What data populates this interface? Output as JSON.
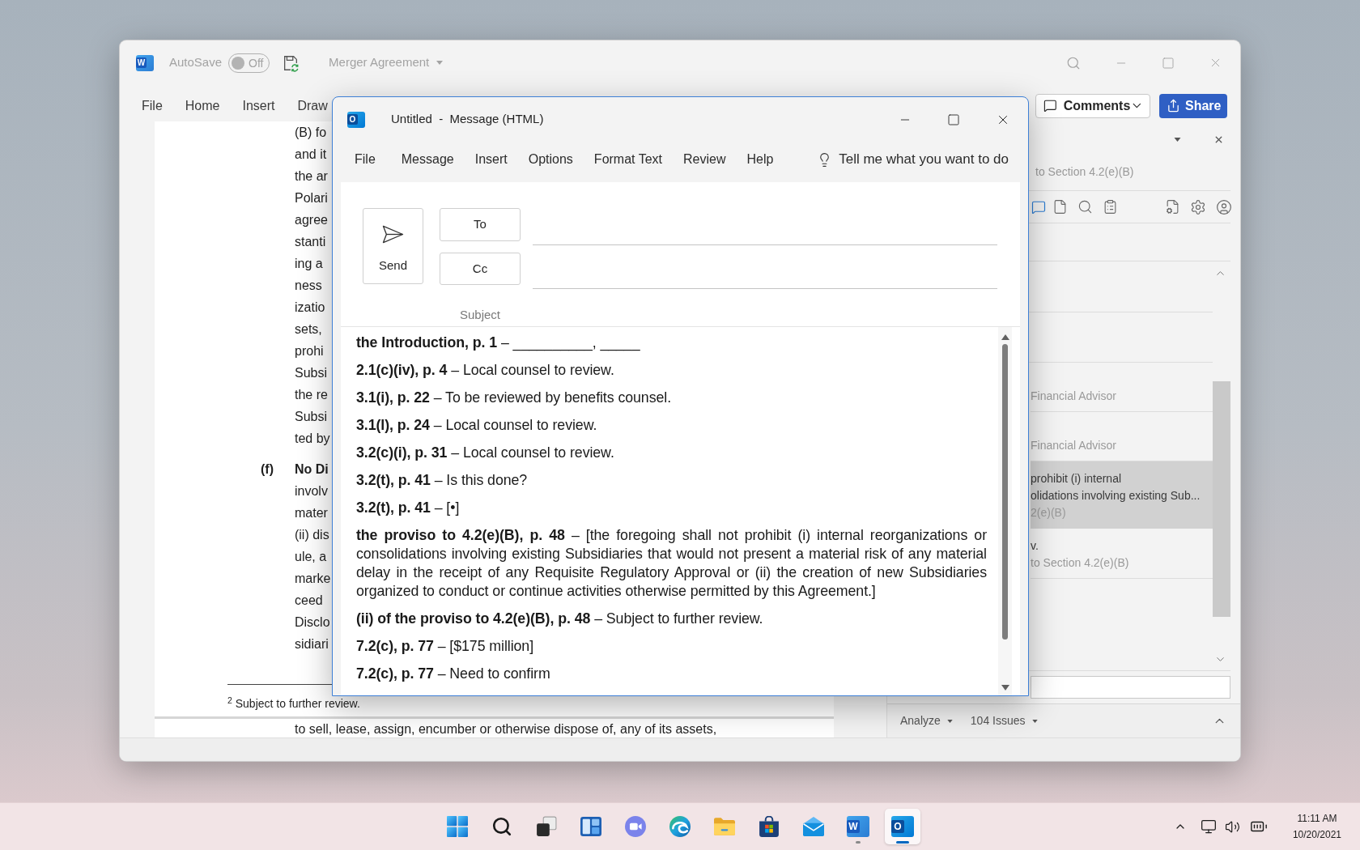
{
  "word_window": {
    "logo_text": "W",
    "autosave": {
      "label": "AutoSave",
      "on": false,
      "state_text": "Off"
    },
    "document_title": "Merger Agreement",
    "ribbon_tabs": [
      "File",
      "Home",
      "Insert",
      "Draw"
    ],
    "comments_button": "Comments",
    "share_button": "Share",
    "document": {
      "clause_lines": [
        "(B) fo",
        "and it",
        "the ar",
        "Polari",
        "agree",
        "stanti",
        "ing a",
        "ness",
        "izatio",
        "sets,",
        "prohi",
        "Subsi",
        "the re",
        "Subsi",
        "ted by"
      ],
      "subsection": {
        "marker": "(f)",
        "heading": "No Di",
        "lines": [
          "involv",
          "mater",
          "(ii) dis",
          "ule, a",
          "marke",
          "ceed",
          "Disclo",
          "sidiari"
        ]
      },
      "footnote": "$^{2}$ Subject to further review.",
      "next_page_line": "to sell, lease, assign, encumber or otherwise dispose of, any of its assets,"
    },
    "side_pane": {
      "subtitle": "to Section 4.2(e)(B)",
      "items": [
        {
          "selected": false,
          "lines": [
            {
              "kind": "secondary",
              "text": "Financial Advisor"
            }
          ]
        },
        {
          "selected": false,
          "lines": [
            {
              "kind": "secondary",
              "text": "Financial Advisor"
            }
          ]
        },
        {
          "selected": true,
          "lines": [
            {
              "kind": "primary",
              "text": "prohibit (i) internal"
            },
            {
              "kind": "primary",
              "text": "olidations involving existing Sub..."
            },
            {
              "kind": "secondary",
              "text": "2(e)(B)"
            }
          ]
        },
        {
          "selected": false,
          "lines": [
            {
              "kind": "primary",
              "text": "v."
            },
            {
              "kind": "secondary",
              "text": "to Section 4.2(e)(B)"
            }
          ]
        }
      ]
    },
    "status_bar": {
      "analyze": "Analyze",
      "issues": "104 Issues"
    }
  },
  "outlook_window": {
    "logo_text": "O",
    "title": "Untitled  -  Message (HTML)",
    "menu_tabs": [
      "File",
      "Message",
      "Insert",
      "Options",
      "Format Text",
      "Review",
      "Help"
    ],
    "tell_me": "Tell me what you want to do",
    "send_button": "Send",
    "to_button": "To",
    "cc_button": "Cc",
    "subject_label": "Subject",
    "body_paragraphs": [
      "**the Introduction, p. 1** – __________, _____",
      "**2.1(c)(iv), p. 4** – Local counsel to review.",
      "**3.1(i), p. 22** – To be reviewed by benefits counsel.",
      "**3.1(l), p. 24** – Local counsel to review.",
      "**3.2(c)(i), p. 31** – Local counsel to review.",
      "**3.2(t), p. 41** – Is this done?",
      "**3.2(t), p. 41** – [•]",
      "**the proviso to 4.2(e)(B), p. 48** – [the foregoing shall not prohibit (i) internal reorganizations or consolidations involving existing Subsidiaries that would not present a material risk of any material delay in the receipt of any Requisite Regulatory Approval or (ii) the creation of new Subsidiaries organized to conduct or continue activities otherwise permitted by this Agreement.]",
      "**(ii) of the proviso to 4.2(e)(B), p. 48** – Subject to further review.",
      "**7.2(c), p. 77** – [$175 million]",
      "**7.2(c), p. 77** – Need to confirm"
    ]
  },
  "taskbar": {
    "apps": [
      {
        "kind": "start",
        "running": false,
        "selected": false
      },
      {
        "kind": "search",
        "running": false,
        "selected": false
      },
      {
        "kind": "task_view",
        "running": false,
        "selected": false
      },
      {
        "kind": "widgets",
        "running": false,
        "selected": false
      },
      {
        "kind": "chat",
        "running": false,
        "selected": false
      },
      {
        "kind": "browser",
        "running": false,
        "selected": false
      },
      {
        "kind": "folder",
        "running": false,
        "selected": false
      },
      {
        "kind": "store",
        "running": false,
        "selected": false
      },
      {
        "kind": "mail",
        "running": false,
        "selected": false
      },
      {
        "kind": "word",
        "running": true,
        "selected": false,
        "logo_text": "W"
      },
      {
        "kind": "outlook",
        "running": true,
        "selected": true,
        "logo_text": "O"
      }
    ],
    "tray": {
      "time": "11:11 AM",
      "date": "10/20/2021"
    }
  }
}
